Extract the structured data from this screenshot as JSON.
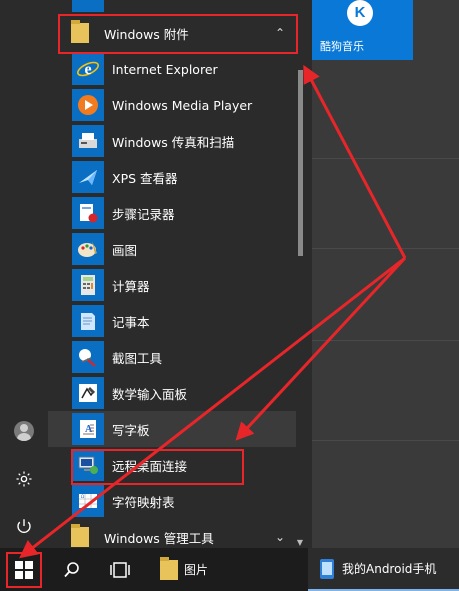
{
  "start_menu": {
    "group_open": {
      "label": "Windows 附件",
      "icon": "folder-icon"
    },
    "apps": [
      {
        "label": "Internet Explorer",
        "icon": "internet-explorer-icon"
      },
      {
        "label": "Windows Media Player",
        "icon": "media-player-icon"
      },
      {
        "label": "Windows 传真和扫描",
        "icon": "fax-scan-icon"
      },
      {
        "label": "XPS 查看器",
        "icon": "xps-viewer-icon"
      },
      {
        "label": "步骤记录器",
        "icon": "steps-recorder-icon"
      },
      {
        "label": "画图",
        "icon": "paint-icon"
      },
      {
        "label": "计算器",
        "icon": "calculator-icon"
      },
      {
        "label": "记事本",
        "icon": "notepad-icon"
      },
      {
        "label": "截图工具",
        "icon": "snipping-tool-icon"
      },
      {
        "label": "数学输入面板",
        "icon": "math-input-icon"
      },
      {
        "label": "写字板",
        "icon": "wordpad-icon"
      },
      {
        "label": "远程桌面连接",
        "icon": "remote-desktop-icon"
      },
      {
        "label": "字符映射表",
        "icon": "character-map-icon"
      }
    ],
    "group_next": {
      "label": "Windows 管理工具",
      "icon": "folder-icon"
    },
    "pinned_tile": {
      "label": "酷狗音乐",
      "logo": "K"
    }
  },
  "taskbar": {
    "pictures_label": "图片",
    "phone_label": "我的Android手机"
  },
  "colors": {
    "accent": "#0a78d7",
    "highlight": "#e8262a"
  }
}
